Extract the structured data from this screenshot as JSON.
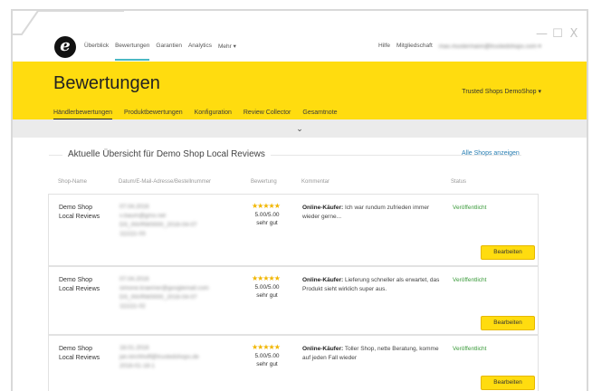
{
  "window": {
    "controls": [
      "—",
      "☐",
      "X"
    ]
  },
  "logo": {
    "letter": "e"
  },
  "nav": {
    "items": [
      "Überblick",
      "Bewertungen",
      "Garantien",
      "Analytics",
      "Mehr ▾"
    ],
    "right": [
      "Hilfe",
      "Mitgliedschaft",
      "max.mustermann@trustedshops.com ▾"
    ]
  },
  "header": {
    "title": "Bewertungen",
    "shop_select": "Trusted Shops DemoShop ▾",
    "subtabs": [
      "Händlerbewertungen",
      "Produktbewertungen",
      "Konfiguration",
      "Review Collector",
      "Gesamtnote"
    ],
    "collapse_icon": "⌄"
  },
  "overview": {
    "title": "Aktuelle Übersicht für Demo Shop Local Reviews",
    "all_shops_link": "Alle Shops anzeigen",
    "columns": [
      "Shop-Name",
      "Datum/E-Mail-Adresse/Bestellnummer",
      "Bewertung",
      "Kommentar",
      "Status"
    ]
  },
  "reviews": [
    {
      "shop": [
        "Demo Shop",
        "Local Reviews"
      ],
      "details": [
        "07.04.2016",
        "s.baum@gmx.net",
        "DS_INVRW0000_2016-04-07",
        "111111-03"
      ],
      "stars": "★★★★★",
      "score": "5.00/5.00",
      "grade": "sehr gut",
      "author": "Online-Käufer:",
      "comment": "Ich war rundum zufrieden immer wieder gerne...",
      "status": "Veröffentlicht",
      "button": "Bearbeiten"
    },
    {
      "shop": [
        "Demo Shop",
        "Local Reviews"
      ],
      "details": [
        "07.04.2016",
        "simone.kraemer@googlemail.com",
        "DS_INVRW0000_2016-04-07",
        "111111-02"
      ],
      "stars": "★★★★★",
      "score": "5.00/5.00",
      "grade": "sehr gut",
      "author": "Online-Käufer:",
      "comment": "Lieferung schneller als erwartet, das Produkt sieht wirklich super aus.",
      "status": "Veröffentlicht",
      "button": "Bearbeiten"
    },
    {
      "shop": [
        "Demo Shop",
        "Local Reviews"
      ],
      "details": [
        "18.01.2016",
        "jan.kirchhoff@trustedshops.de",
        "2016-01-18-1"
      ],
      "stars": "★★★★★",
      "score": "5.00/5.00",
      "grade": "sehr gut",
      "author": "Online-Käufer:",
      "comment": "Toller Shop, nette Beratung, komme auf jeden Fall wieder",
      "status": "Veröffentlicht",
      "button": "Bearbeiten"
    }
  ]
}
